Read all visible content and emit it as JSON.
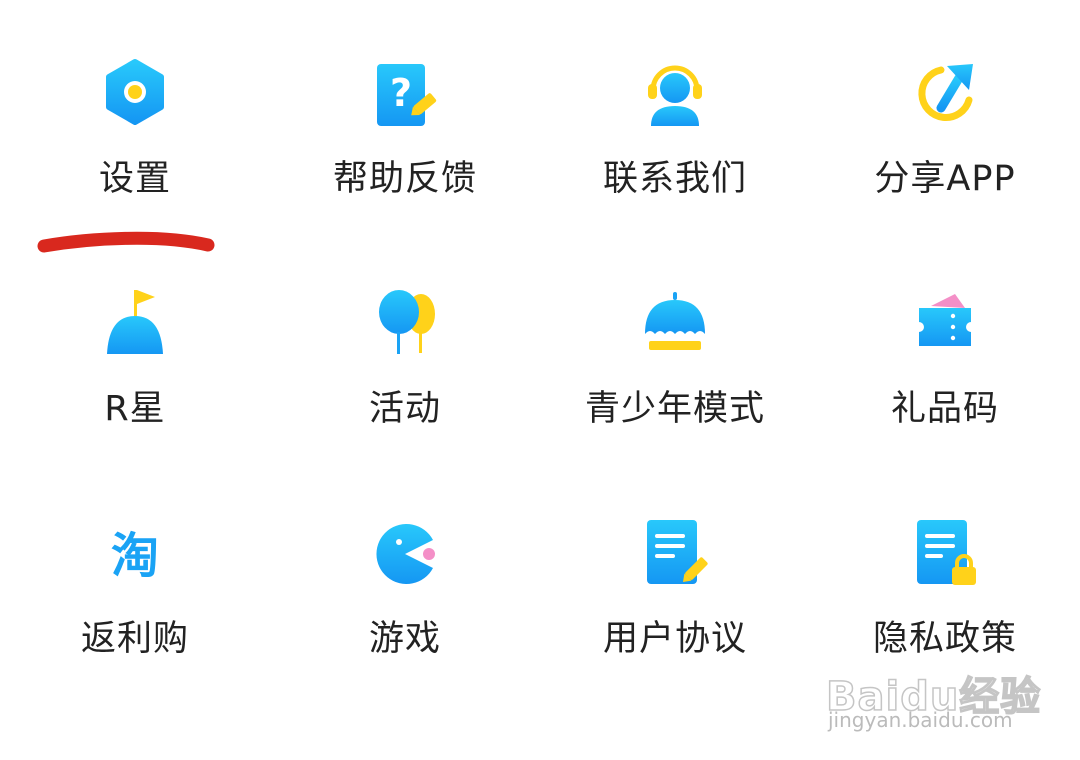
{
  "menu": {
    "items": [
      {
        "label": "设置",
        "icon": "settings-hexagon-icon"
      },
      {
        "label": "帮助反馈",
        "icon": "help-feedback-icon"
      },
      {
        "label": "联系我们",
        "icon": "customer-service-headset-icon"
      },
      {
        "label": "分享APP",
        "icon": "share-arrow-icon"
      },
      {
        "label": "R星",
        "icon": "planet-flag-icon"
      },
      {
        "label": "活动",
        "icon": "balloons-icon"
      },
      {
        "label": "青少年模式",
        "icon": "umbrella-icon"
      },
      {
        "label": "礼品码",
        "icon": "gift-ticket-icon"
      },
      {
        "label": "返利购",
        "icon": "taobao-icon"
      },
      {
        "label": "游戏",
        "icon": "pacman-game-icon"
      },
      {
        "label": "用户协议",
        "icon": "user-agreement-document-icon"
      },
      {
        "label": "隐私政策",
        "icon": "privacy-policy-lock-icon"
      }
    ]
  },
  "annotation": {
    "type": "red-brush-underline",
    "target": "设置",
    "color": "#d9281e"
  },
  "colors": {
    "primary_blue": "#1aa3f5",
    "accent_yellow": "#ffd21a",
    "accent_pink": "#f48fc7",
    "label_text": "#222222"
  },
  "watermark": {
    "logo": "Baidu经验",
    "url": "jingyan.baidu.com"
  }
}
